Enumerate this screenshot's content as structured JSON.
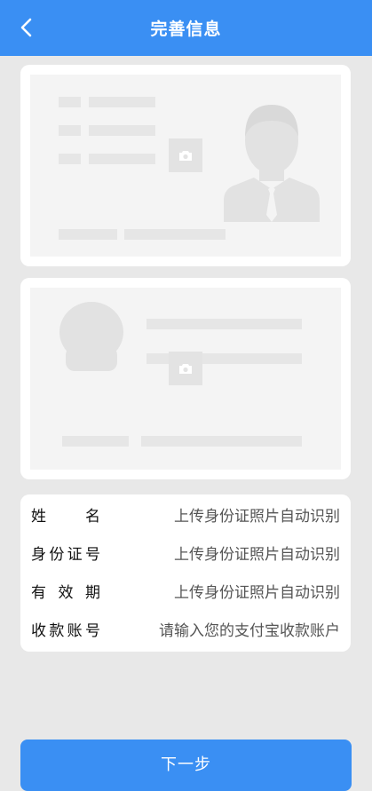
{
  "header": {
    "title": "完善信息",
    "back_icon": "chevron-left-icon",
    "bg_color": "#3a8ff3"
  },
  "upload_cards": [
    {
      "name": "id-card-front",
      "icon": "camera-icon"
    },
    {
      "name": "id-card-back",
      "icon": "camera-icon"
    }
  ],
  "form": {
    "rows": [
      {
        "label": "姓名",
        "value": "上传身份证照片自动识别"
      },
      {
        "label": "身份证号",
        "value": "上传身份证照片自动识别"
      },
      {
        "label": "有效期",
        "value": "上传身份证照片自动识别"
      },
      {
        "label": "收款账号",
        "placeholder": "请输入您的支付宝收款账户"
      }
    ]
  },
  "footer": {
    "next_label": "下一步"
  }
}
